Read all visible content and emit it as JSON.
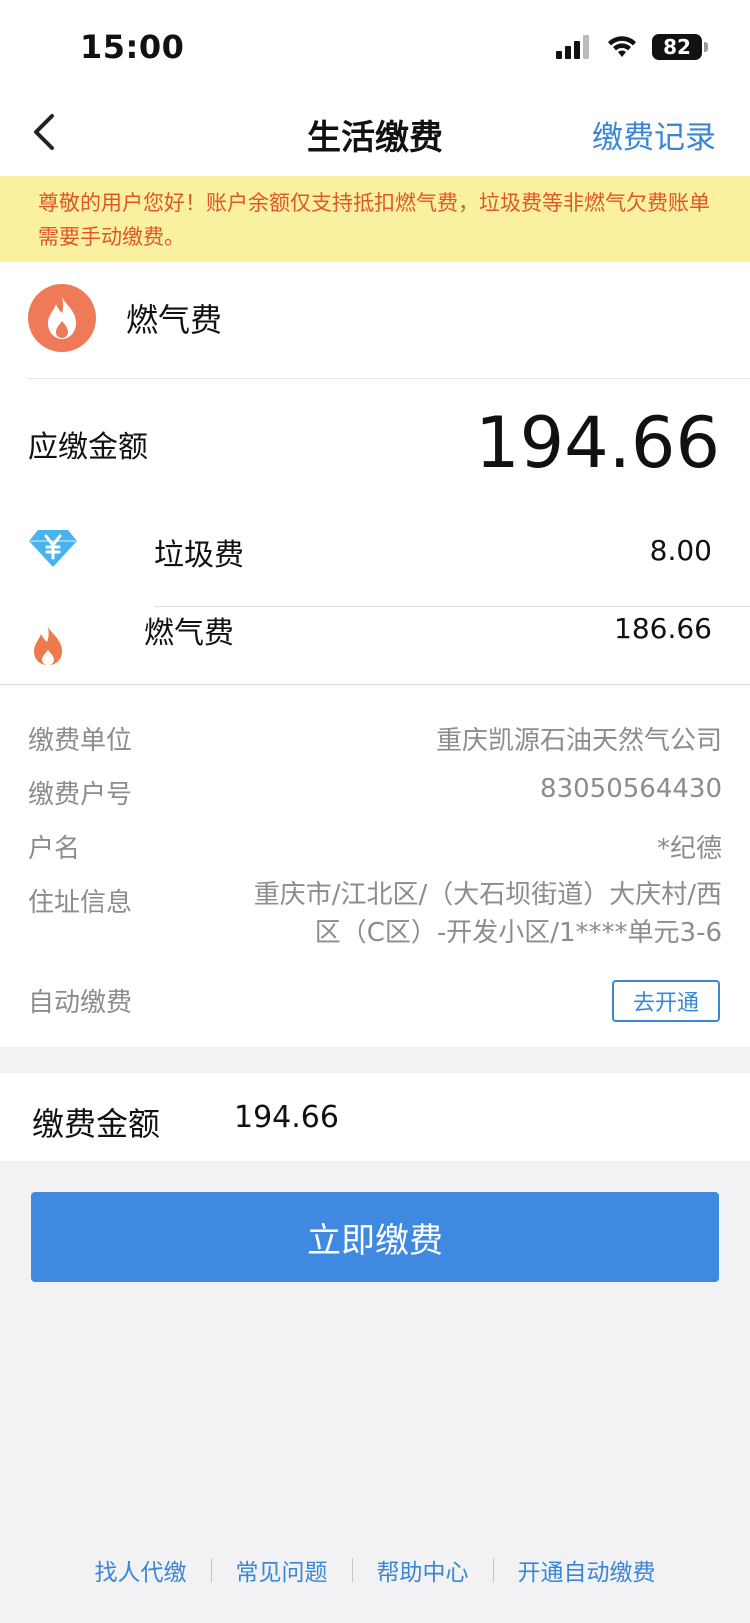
{
  "status_bar": {
    "time": "15:00",
    "battery": "82"
  },
  "nav": {
    "title": "生活缴费",
    "right_link": "缴费记录"
  },
  "notice": "尊敬的用户您好！账户余额仅支持抵扣燃气费，垃圾费等非燃气欠费账单需要手动缴费。",
  "bill": {
    "category": "燃气费",
    "due_label": "应缴金额",
    "due_amount": "194.66",
    "items": [
      {
        "label": "垃圾费",
        "value": "8.00",
        "icon": "yen-diamond-icon"
      },
      {
        "label": "燃气费",
        "value": "186.66",
        "icon": "flame-icon"
      }
    ]
  },
  "info": {
    "unit_label": "缴费单位",
    "unit_value": "重庆凯源石油天然气公司",
    "account_label": "缴费户号",
    "account_value": "83050564430",
    "name_label": "户名",
    "name_value": "*纪德",
    "address_label": "住址信息",
    "address_value": "重庆市/江北区/（大石坝街道）大庆村/西区（C区）-开发小区/1****单元3-6",
    "auto_label": "自动缴费",
    "auto_button": "去开通"
  },
  "payment": {
    "label": "缴费金额",
    "amount": "194.66",
    "button": "立即缴费"
  },
  "footer_links": [
    "找人代缴",
    "常见问题",
    "帮助中心",
    "开通自动缴费"
  ],
  "colors": {
    "accent": "#3f89e1",
    "link": "#3a87d6",
    "warning_bg": "#faf1a0",
    "warning_text": "#e0562b",
    "gas_icon": "#ef7a58",
    "yen_icon": "#49b3ee"
  }
}
